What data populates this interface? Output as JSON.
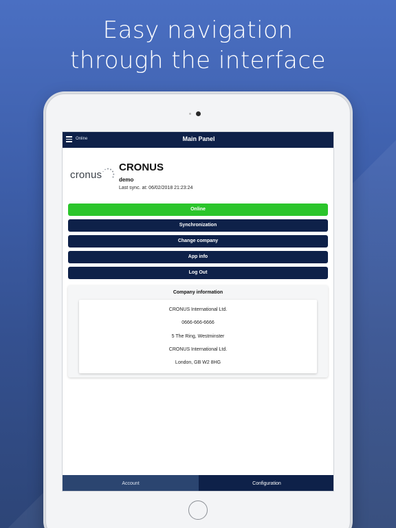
{
  "promo": {
    "headline_line1": "Easy navigation",
    "headline_line2": "through the interface"
  },
  "colors": {
    "nav_dark": "#0e2149",
    "online_green": "#2bc52b",
    "tab_active": "#2b4570"
  },
  "header": {
    "menu_icon": "hamburger-menu-icon",
    "status": "Online",
    "title": "Main Panel"
  },
  "company": {
    "logo_text": "cronus",
    "name": "CRONUS",
    "user": "demo",
    "last_sync": "Last sync. at: 06/02/2018 21:23:24"
  },
  "buttons": {
    "online": "Online",
    "synchronization": "Synchronization",
    "change_company": "Change company",
    "app_info": "App info",
    "log_out": "Log Out"
  },
  "company_info": {
    "title": "Company information",
    "lines": [
      "CRONUS International Ltd.",
      "0666-666-6666",
      "5 The Ring, Westminster",
      "CRONUS International Ltd.",
      "London, GB W2 8HG"
    ]
  },
  "tabs": {
    "account": "Account",
    "configuration": "Configuration"
  }
}
